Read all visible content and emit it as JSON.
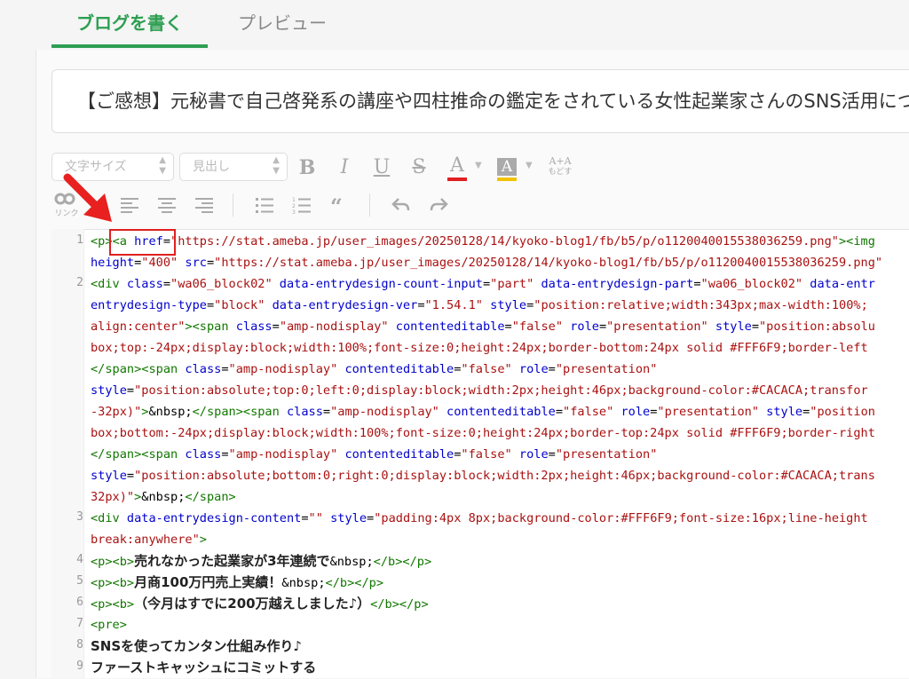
{
  "tabs": {
    "write": "ブログを書く",
    "preview": "プレビュー"
  },
  "title": "【ご感想】元秘書で自己啓発系の講座や四柱推命の鑑定をされている女性起業家さんのSNS活用につ",
  "toolbar": {
    "font_size": "文字サイズ",
    "heading": "見出し",
    "bold": "B",
    "italic": "I",
    "underline": "U",
    "strike": "S",
    "text_color": "A",
    "bg_color": "A",
    "undo_format_top": "A+A",
    "undo_format_bottom": "もどす",
    "link": "リンク",
    "colors": {
      "text": "#e02020",
      "highlight": "#f2c200"
    }
  },
  "code": {
    "line_numbers": [
      "1",
      "2",
      "3",
      "4",
      "5",
      "6",
      "7",
      "8",
      "9"
    ],
    "l1a": "<p>",
    "l1b": "<a",
    "l1c": " href",
    "l1d": "=",
    "l1e": "\"https://stat.ameba.jp/user_images/20250128/14/kyoko-blog1/fb/b5/p/o1120040015538036259.png\"",
    "l1f": "><img",
    "l1w_a": "height",
    "l1w_b": "=",
    "l1w_c": "\"400\"",
    "l1w_d": " src",
    "l1w_e": "=",
    "l1w_f": "\"https://stat.ameba.jp/user_images/20250128/14/kyoko-blog1/fb/b5/p/o1120040015538036259.png\"",
    "l2": [
      [
        "t",
        "<div"
      ],
      [
        "a",
        " class"
      ],
      [
        "b",
        "="
      ],
      [
        "s",
        "\"wa06_block02\""
      ],
      [
        "a",
        " data-entrydesign-count-input"
      ],
      [
        "b",
        "="
      ],
      [
        "s",
        "\"part\""
      ],
      [
        "a",
        " data-entrydesign-part"
      ],
      [
        "b",
        "="
      ],
      [
        "s",
        "\"wa06_block02\""
      ],
      [
        "a",
        " data-entr"
      ]
    ],
    "l2w1": [
      [
        "a",
        "entrydesign-type"
      ],
      [
        "b",
        "="
      ],
      [
        "s",
        "\"block\""
      ],
      [
        "a",
        " data-entrydesign-ver"
      ],
      [
        "b",
        "="
      ],
      [
        "s",
        "\"1.54.1\""
      ],
      [
        "a",
        " style"
      ],
      [
        "b",
        "="
      ],
      [
        "s",
        "\"position:relative;width:343px;max-width:100%;"
      ]
    ],
    "l2w2": [
      [
        "s",
        "align:center\""
      ],
      [
        "t",
        "><span"
      ],
      [
        "a",
        " class"
      ],
      [
        "b",
        "="
      ],
      [
        "s",
        "\"amp-nodisplay\""
      ],
      [
        "a",
        " contenteditable"
      ],
      [
        "b",
        "="
      ],
      [
        "s",
        "\"false\""
      ],
      [
        "a",
        " role"
      ],
      [
        "b",
        "="
      ],
      [
        "s",
        "\"presentation\""
      ],
      [
        "a",
        " style"
      ],
      [
        "b",
        "="
      ],
      [
        "s",
        "\"position:absolu"
      ]
    ],
    "l2w3": [
      [
        "s",
        "box;top:-24px;display:block;width:100%;font-size:0;height:24px;border-bottom:24px solid #FFF6F9;border-left"
      ]
    ],
    "l2w4": [
      [
        "t",
        "</span><span"
      ],
      [
        "a",
        " class"
      ],
      [
        "b",
        "="
      ],
      [
        "s",
        "\"amp-nodisplay\""
      ],
      [
        "a",
        " contenteditable"
      ],
      [
        "b",
        "="
      ],
      [
        "s",
        "\"false\""
      ],
      [
        "a",
        " role"
      ],
      [
        "b",
        "="
      ],
      [
        "s",
        "\"presentation\""
      ]
    ],
    "l2w5": [
      [
        "a",
        "style"
      ],
      [
        "b",
        "="
      ],
      [
        "s",
        "\"position:absolute;top:0;left:0;display:block;width:2px;height:46px;background-color:#CACACA;transfor"
      ]
    ],
    "l2w6": [
      [
        "s",
        "-32px)\""
      ],
      [
        "t",
        ">"
      ],
      [
        "b",
        "&nbsp;"
      ],
      [
        "t",
        "</span><span"
      ],
      [
        "a",
        " class"
      ],
      [
        "b",
        "="
      ],
      [
        "s",
        "\"amp-nodisplay\""
      ],
      [
        "a",
        " contenteditable"
      ],
      [
        "b",
        "="
      ],
      [
        "s",
        "\"false\""
      ],
      [
        "a",
        " role"
      ],
      [
        "b",
        "="
      ],
      [
        "s",
        "\"presentation\""
      ],
      [
        "a",
        " style"
      ],
      [
        "b",
        "="
      ],
      [
        "s",
        "\"position"
      ]
    ],
    "l2w7": [
      [
        "s",
        "box;bottom:-24px;display:block;width:100%;font-size:0;height:24px;border-top:24px solid #FFF6F9;border-right"
      ]
    ],
    "l2w8": [
      [
        "t",
        "</span><span"
      ],
      [
        "a",
        " class"
      ],
      [
        "b",
        "="
      ],
      [
        "s",
        "\"amp-nodisplay\""
      ],
      [
        "a",
        " contenteditable"
      ],
      [
        "b",
        "="
      ],
      [
        "s",
        "\"false\""
      ],
      [
        "a",
        " role"
      ],
      [
        "b",
        "="
      ],
      [
        "s",
        "\"presentation\""
      ]
    ],
    "l2w9": [
      [
        "a",
        "style"
      ],
      [
        "b",
        "="
      ],
      [
        "s",
        "\"position:absolute;bottom:0;right:0;display:block;width:2px;height:46px;background-color:#CACACA;trans"
      ]
    ],
    "l2w10": [
      [
        "s",
        "32px)\""
      ],
      [
        "t",
        ">"
      ],
      [
        "b",
        "&nbsp;"
      ],
      [
        "t",
        "</span>"
      ]
    ],
    "l3": [
      [
        "t",
        "<div"
      ],
      [
        "a",
        " data-entrydesign-content"
      ],
      [
        "b",
        "="
      ],
      [
        "s",
        "\"\""
      ],
      [
        "a",
        " style"
      ],
      [
        "b",
        "="
      ],
      [
        "s",
        "\"padding:4px 8px;background-color:#FFF6F9;font-size:16px;line-height"
      ]
    ],
    "l3w": [
      [
        "s",
        "break:anywhere\""
      ],
      [
        "t",
        ">"
      ]
    ],
    "l4": [
      [
        "t",
        "<p><b>"
      ],
      [
        "j",
        "売れなかった起業家が3年連続で"
      ],
      [
        "b",
        "&nbsp;"
      ],
      [
        "t",
        "</b></p>"
      ]
    ],
    "l5": [
      [
        "t",
        "<p><b>"
      ],
      [
        "j",
        "月商100万円売上実績！"
      ],
      [
        "b",
        "&nbsp;"
      ],
      [
        "t",
        "</b></p>"
      ]
    ],
    "l6": [
      [
        "t",
        "<p><b>"
      ],
      [
        "j",
        "（今月はすでに200万越えしました♪）"
      ],
      [
        "t",
        "</b></p>"
      ]
    ],
    "l7": [
      [
        "t",
        "<pre>"
      ]
    ],
    "l8": [
      [
        "j",
        "SNSを使ってカンタン仕組み作り♪"
      ]
    ],
    "l9": [
      [
        "j",
        "ファーストキャッシュにコミットする"
      ]
    ]
  }
}
